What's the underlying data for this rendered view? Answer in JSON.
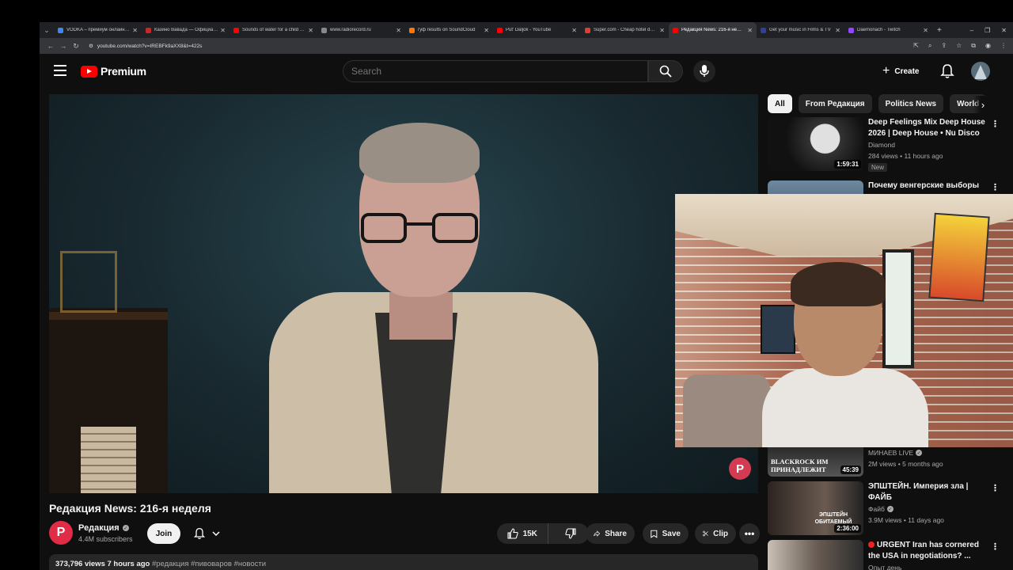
{
  "browser": {
    "tabs": [
      {
        "label": "VODKA – премиум онлайн-…",
        "color": "#4285f4",
        "active": false
      },
      {
        "label": "Казино Вавада — Официаль…",
        "color": "#c62828",
        "active": false
      },
      {
        "label": "Sounds of water for a child to…",
        "color": "#ff0000",
        "active": false
      },
      {
        "label": "www.radiorecord.ru",
        "color": "#888888",
        "active": false
      },
      {
        "label": "гуф results on SoundCloud",
        "color": "#ff7700",
        "active": false
      },
      {
        "label": "Put' Daljok - YouTube",
        "color": "#ff0000",
        "active": false
      },
      {
        "label": "Super.com - Cheap hotel dea…",
        "color": "#e53935",
        "active": false
      },
      {
        "label": "Редакция News: 216-я не…",
        "color": "#ff0000",
        "active": true
      },
      {
        "label": "Get your music in Films & TV",
        "color": "#303f9f",
        "active": false
      },
      {
        "label": "Daemonach - Twitch",
        "color": "#9146ff",
        "active": false
      }
    ],
    "url": "youtube.com/watch?v=IREBFk9aXX8&t=422s"
  },
  "header": {
    "logo_text": "Premium",
    "search_placeholder": "Search",
    "create_label": "Create"
  },
  "video": {
    "title": "Редакция News: 216-я неделя",
    "watermark": "P",
    "channel": {
      "avatar_letter": "P",
      "name": "Редакция",
      "subscribers": "4.4M subscribers"
    },
    "join_label": "Join",
    "like_count": "15K",
    "share_label": "Share",
    "save_label": "Save",
    "clip_label": "Clip",
    "more_label": "•••",
    "description": {
      "stats": "373,796 views  7 hours ago",
      "tags": "#редакция #пивоваров #новости"
    }
  },
  "sidebar": {
    "chips": [
      "All",
      "From Редакция",
      "Politics News",
      "World"
    ],
    "recs": [
      {
        "title": "Deep Feelings Mix Deep House 2026 | Deep House • Nu Disco ...",
        "channel": "Diamond",
        "meta": "284 views • 11 hours ago",
        "badge": "New",
        "duration": "1:59:31"
      },
      {
        "title": "Почему венгерские выборы",
        "channel": "",
        "meta": "",
        "badge": "",
        "duration": ""
      },
      {
        "title": "",
        "channel": "МИНАЕВ LIVE",
        "meta": "2M views • 5 months ago",
        "badge": "",
        "duration": "45:39",
        "thumb_text": "BLACKROCK ИМ ПРИНАДЛЕЖИТ"
      },
      {
        "title": "ЭПШТЕЙН. Империя зла | ФАЙБ",
        "channel": "Файб",
        "meta": "3.9M views • 11 days ago",
        "badge": "",
        "duration": "2:36:00",
        "thumb_text": "ЭПШТЕЙН ОБИТАЕМЫЙ"
      },
      {
        "title": "URGENT Iran has cornered the USA in negotiations? ...",
        "channel": "Опыт день",
        "meta": "",
        "badge": "",
        "duration": ""
      }
    ]
  },
  "colors": {
    "youtube_red": "#ff0000",
    "page_bg": "#0f0f0f",
    "chip_bg": "#272727",
    "channel_brand": "#e02c47"
  }
}
